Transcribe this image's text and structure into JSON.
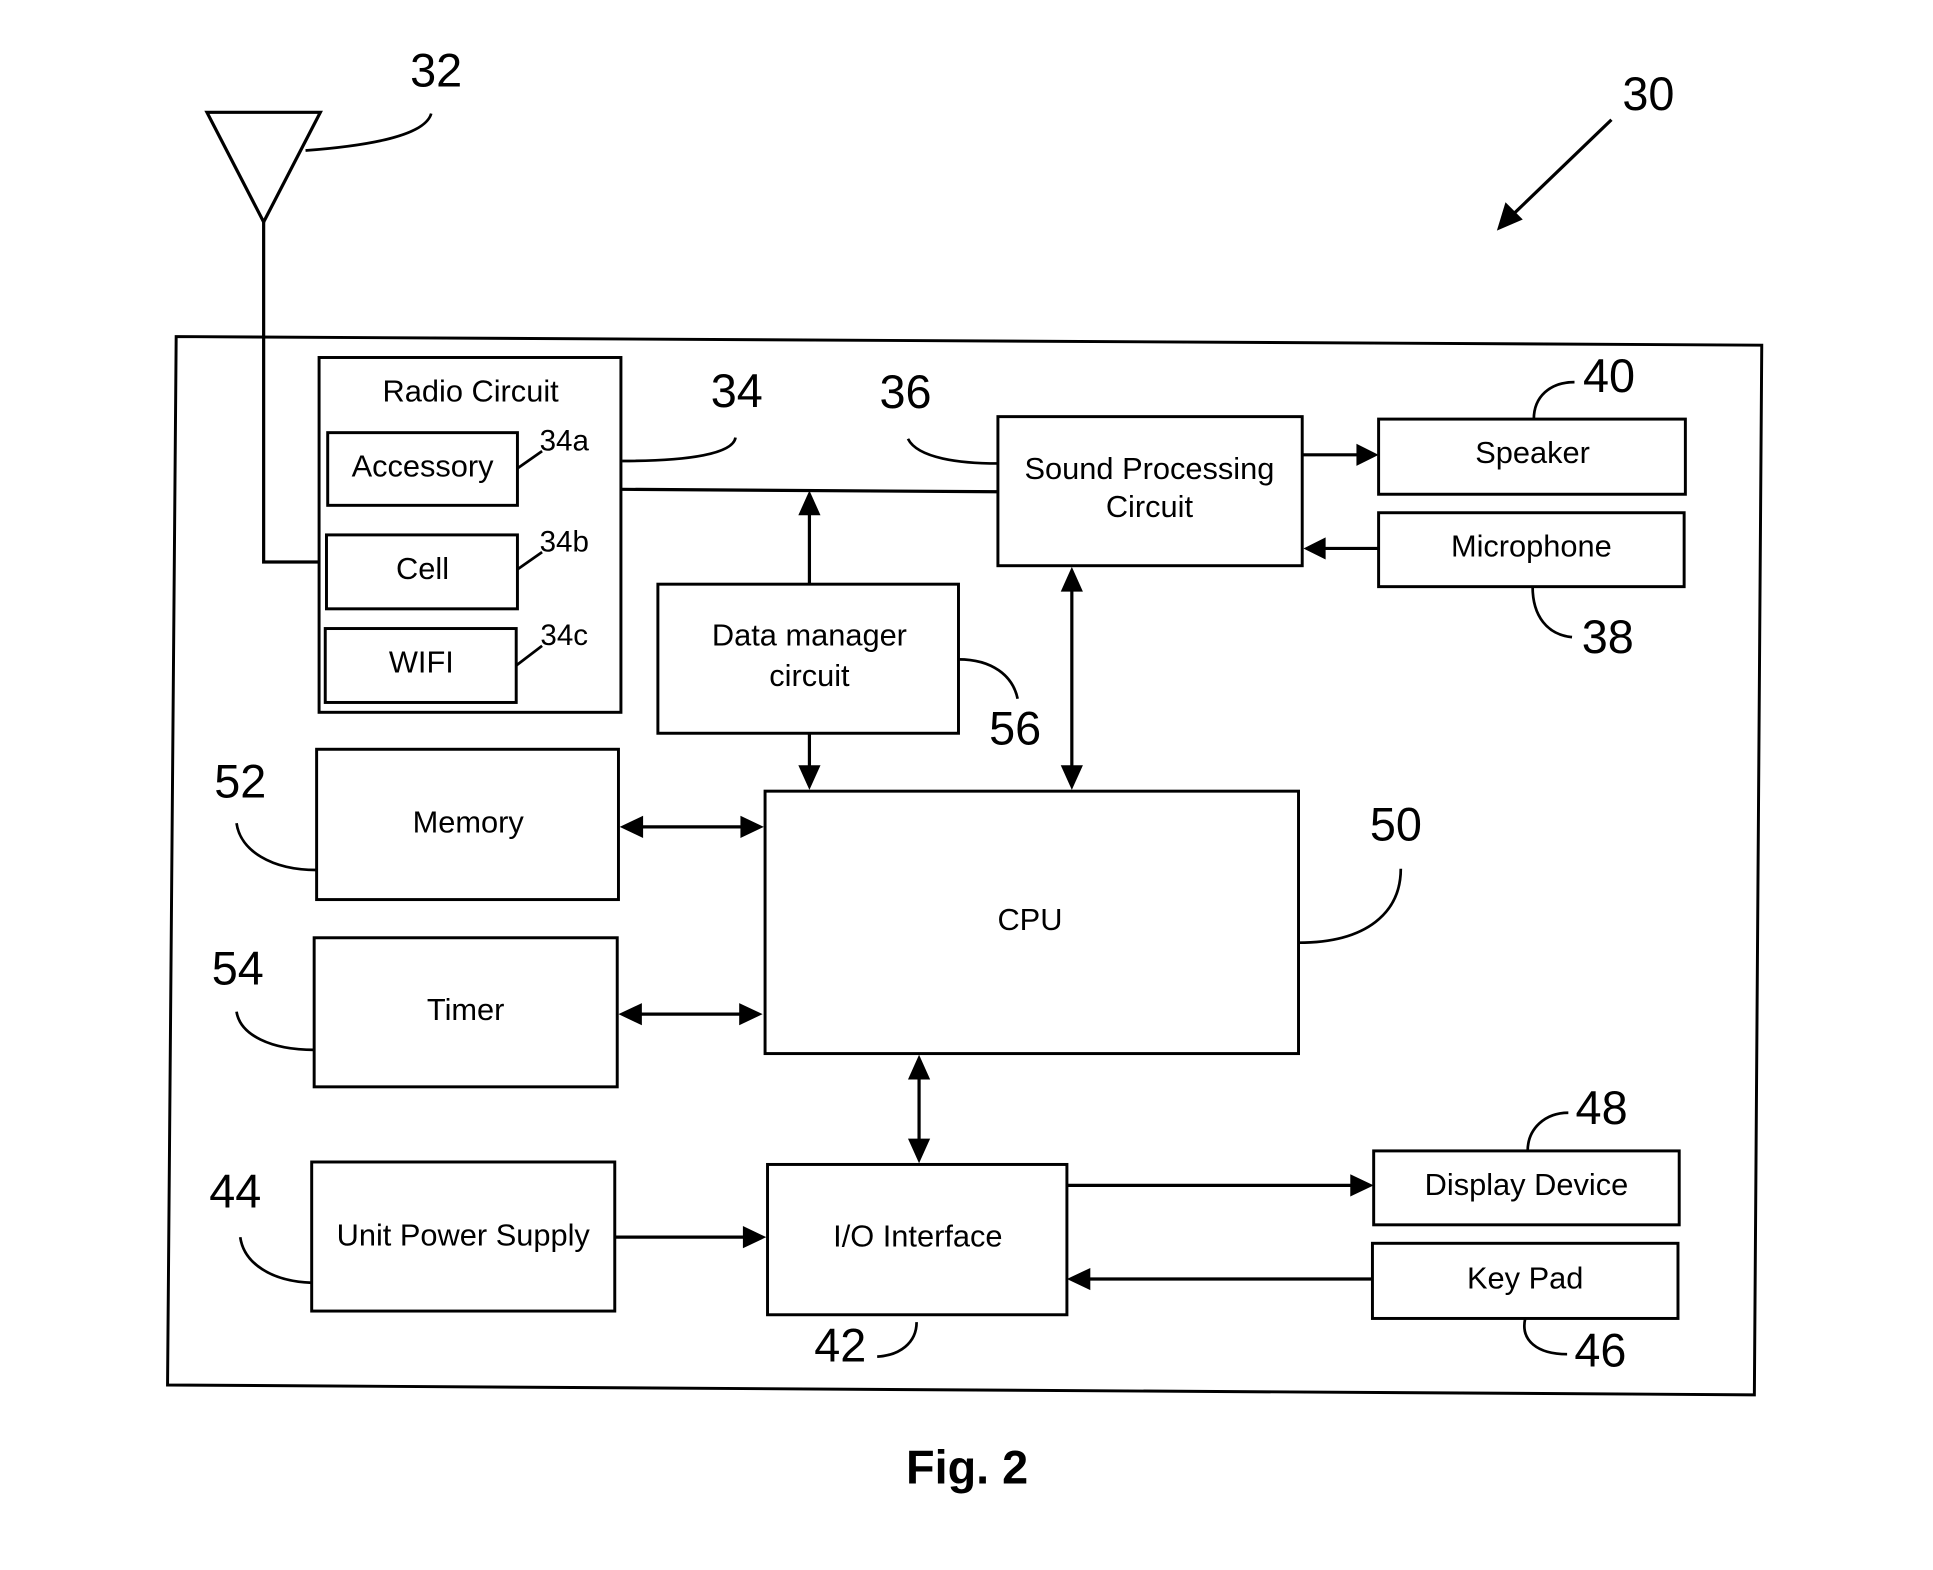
{
  "figure": {
    "caption": "Fig. 2",
    "device_ref": "30",
    "antenna_ref": "32"
  },
  "blocks": {
    "radio_circuit": {
      "label": "Radio Circuit",
      "ref": "34"
    },
    "accessory": {
      "label": "Accessory",
      "ref": "34a"
    },
    "cell": {
      "label": "Cell",
      "ref": "34b"
    },
    "wifi": {
      "label": "WIFI",
      "ref": "34c"
    },
    "sound_processing": {
      "label_line1": "Sound Processing",
      "label_line2": "Circuit",
      "ref": "36"
    },
    "speaker": {
      "label": "Speaker",
      "ref": "40"
    },
    "microphone": {
      "label": "Microphone",
      "ref": "38"
    },
    "data_manager": {
      "label_line1": "Data manager",
      "label_line2": "circuit",
      "ref": "56"
    },
    "memory": {
      "label": "Memory",
      "ref": "52"
    },
    "cpu": {
      "label": "CPU",
      "ref": "50"
    },
    "timer": {
      "label": "Timer",
      "ref": "54"
    },
    "power_supply": {
      "label": "Unit Power Supply",
      "ref": "44"
    },
    "io_interface": {
      "label": "I/O Interface",
      "ref": "42"
    },
    "display_device": {
      "label": "Display Device",
      "ref": "48"
    },
    "key_pad": {
      "label": "Key Pad",
      "ref": "46"
    }
  }
}
